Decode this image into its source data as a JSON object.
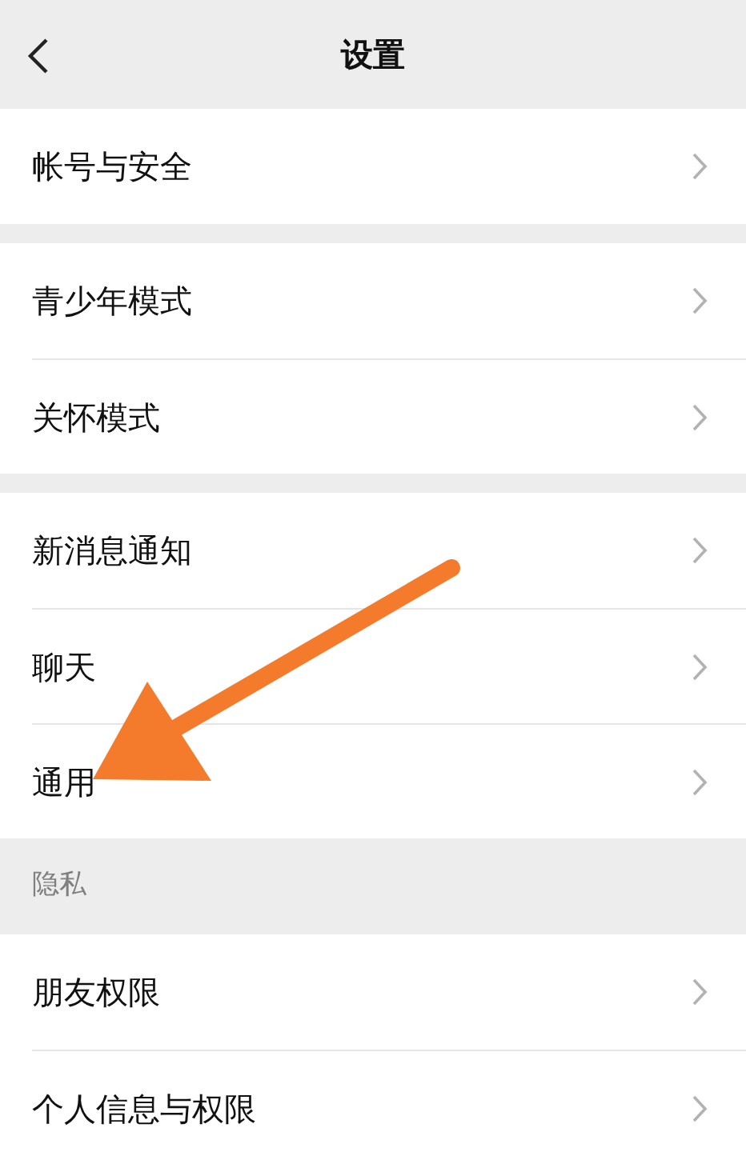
{
  "title": "设置",
  "sections": [
    {
      "items": [
        {
          "label": "帐号与安全"
        }
      ]
    },
    {
      "items": [
        {
          "label": "青少年模式"
        },
        {
          "label": "关怀模式"
        }
      ]
    },
    {
      "items": [
        {
          "label": "新消息通知"
        },
        {
          "label": "聊天"
        },
        {
          "label": "通用"
        }
      ]
    },
    {
      "header": "隐私",
      "items": [
        {
          "label": "朋友权限"
        },
        {
          "label": "个人信息与权限"
        }
      ]
    }
  ]
}
